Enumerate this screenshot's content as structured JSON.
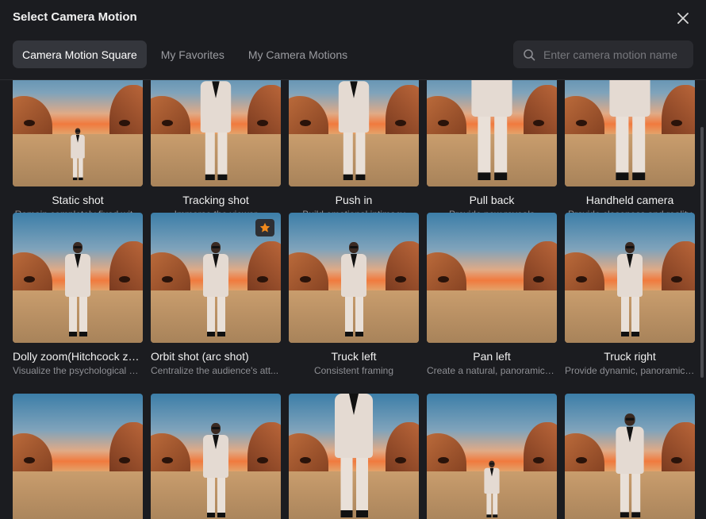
{
  "dialog": {
    "title": "Select Camera Motion",
    "tabs": [
      {
        "label": "Camera Motion Square",
        "active": true
      },
      {
        "label": "My Favorites",
        "active": false
      },
      {
        "label": "My Camera Motions",
        "active": false
      }
    ],
    "search": {
      "placeholder": "Enter camera motion name",
      "value": ""
    }
  },
  "colors": {
    "accent": "#f08a1c",
    "background": "#1b1c20",
    "active_tab": "#34363c"
  },
  "motions": [
    {
      "name": "Static shot",
      "description": "Remain completely fixed wit..."
    },
    {
      "name": "Tracking shot",
      "description": "Immerse the viewer"
    },
    {
      "name": "Push in",
      "description": "Build emotional intimacy"
    },
    {
      "name": "Pull back",
      "description": "Provide new reveals"
    },
    {
      "name": "Handheld camera",
      "description": "Provide closeness and reality"
    },
    {
      "name": "Dolly zoom(Hitchcock zo...",
      "description": "Visualize the psychological st..."
    },
    {
      "name": "Orbit shot (arc shot)",
      "description": "Centralize the audience's att...",
      "favorite": true
    },
    {
      "name": "Truck left",
      "description": "Consistent framing"
    },
    {
      "name": "Pan left",
      "description": "Create a natural, panoramic s..."
    },
    {
      "name": "Truck right",
      "description": "Provide dynamic, panoramic ..."
    },
    {
      "name": "",
      "description": ""
    },
    {
      "name": "",
      "description": ""
    },
    {
      "name": "",
      "description": ""
    },
    {
      "name": "",
      "description": ""
    },
    {
      "name": "",
      "description": ""
    }
  ]
}
